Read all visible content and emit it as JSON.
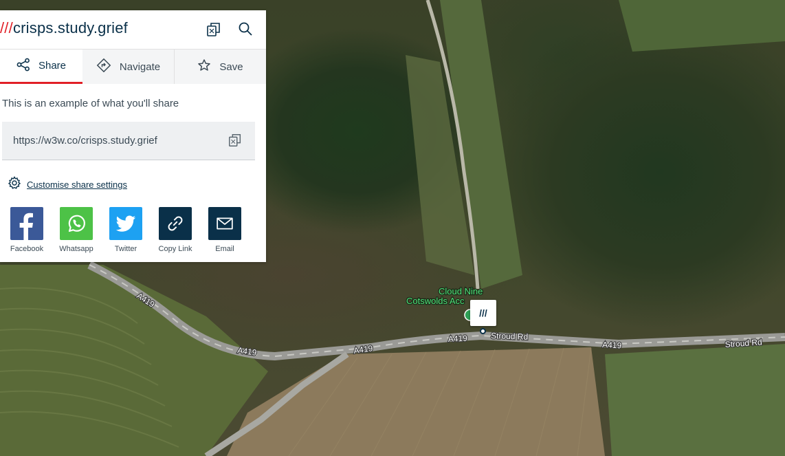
{
  "colors": {
    "brand_red": "#e11f26",
    "brand_navy": "#0a3049",
    "facebook": "#3b5998",
    "whatsapp": "#4dc247",
    "twitter": "#1da1f2",
    "copy_link": "#0a3049",
    "email": "#0a3049",
    "poi_green": "#4fe07a"
  },
  "header": {
    "slashes": "///",
    "address": "crisps.study.grief",
    "copy_icon": "copy-icon",
    "search_icon": "search-icon"
  },
  "tabs": [
    {
      "label": "Share",
      "icon": "share-icon",
      "active": true
    },
    {
      "label": "Navigate",
      "icon": "navigate-icon",
      "active": false
    },
    {
      "label": "Save",
      "icon": "star-icon",
      "active": false
    }
  ],
  "share": {
    "intro": "This is an example of what you'll share",
    "url": "https://w3w.co/crisps.study.grief",
    "customise_label": "Customise share settings",
    "buttons": [
      {
        "label": "Facebook",
        "icon": "facebook-icon"
      },
      {
        "label": "Whatsapp",
        "icon": "whatsapp-icon"
      },
      {
        "label": "Twitter",
        "icon": "twitter-icon"
      },
      {
        "label": "Copy Link",
        "icon": "link-icon"
      },
      {
        "label": "Email",
        "icon": "email-icon"
      }
    ]
  },
  "map": {
    "road_labels": [
      "A419",
      "A419",
      "A419",
      "A419",
      "A419",
      "Stroud Rd",
      "Stroud Rd"
    ],
    "poi": {
      "line1": "Cloud Nine",
      "line2": "Cotswolds Acc"
    },
    "pin_label": "///"
  }
}
